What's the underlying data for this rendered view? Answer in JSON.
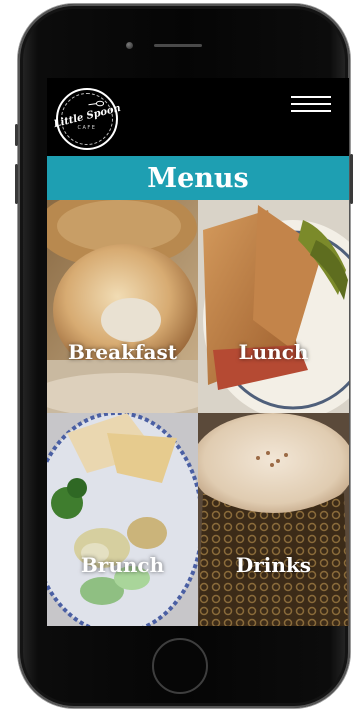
{
  "logo": {
    "name": "Little Spoon",
    "sub": "CAFE"
  },
  "page": {
    "title": "Menus"
  },
  "menu": {
    "items": [
      {
        "label": "Breakfast"
      },
      {
        "label": "Lunch"
      },
      {
        "label": "Brunch"
      },
      {
        "label": "Drinks"
      }
    ]
  },
  "colors": {
    "accent": "#1e9fb2",
    "background": "#000000",
    "text": "#ffffff"
  },
  "icons": {
    "menu": "hamburger-menu-icon"
  }
}
